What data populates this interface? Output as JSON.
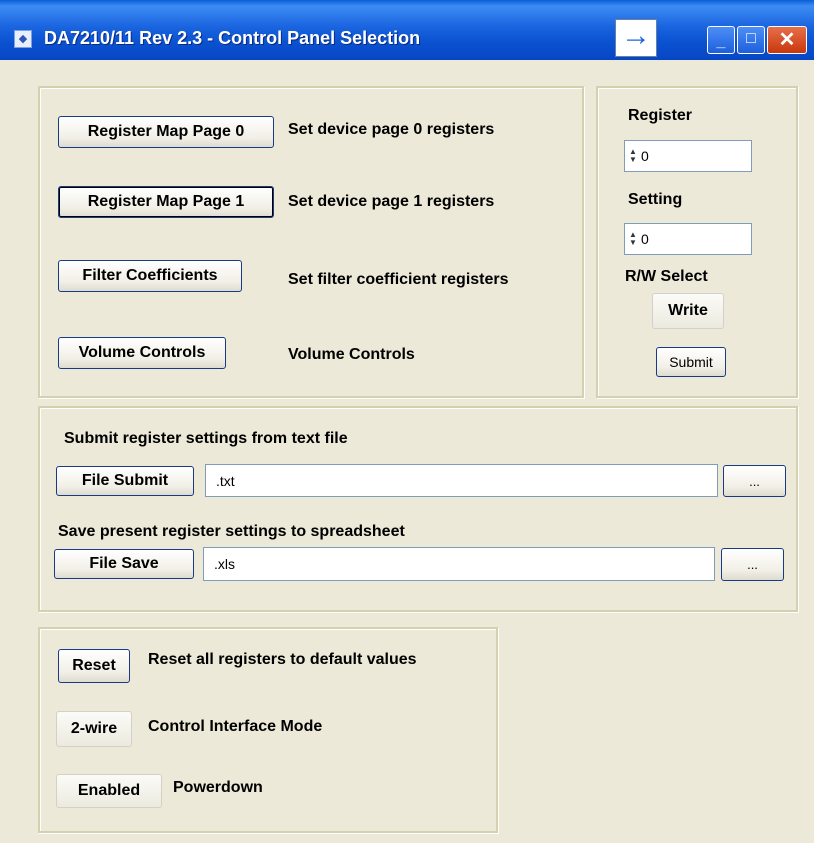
{
  "window": {
    "title": "DA7210/11 Rev 2.3 - Control Panel Selection",
    "arrow_glyph": "→",
    "minimize_glyph": "_",
    "maximize_glyph": "□",
    "close_glyph": "✕"
  },
  "pages": {
    "items": [
      {
        "button": "Register Map Page 0",
        "desc": "Set device page 0 registers"
      },
      {
        "button": "Register Map Page 1",
        "desc": "Set device page 1 registers"
      },
      {
        "button": "Filter Coefficients",
        "desc": "Set filter coefficient registers"
      },
      {
        "button": "Volume Controls",
        "desc": "Volume Controls"
      }
    ]
  },
  "register_panel": {
    "register_label": "Register",
    "register_value": "0",
    "setting_label": "Setting",
    "setting_value": "0",
    "rw_label": "R/W Select",
    "rw_button": "Write",
    "submit_button": "Submit"
  },
  "file_panel": {
    "submit_heading": "Submit register settings from text file",
    "submit_button": "File Submit",
    "submit_path": ".txt",
    "browse_label": "...",
    "save_heading": "Save present register settings to spreadsheet",
    "save_button": "File Save",
    "save_path": ".xls"
  },
  "control_panel": {
    "reset_button": "Reset",
    "reset_desc": "Reset all registers to default values",
    "mode_button": "2-wire",
    "mode_desc": "Control Interface Mode",
    "power_button": "Enabled",
    "power_desc": "Powerdown"
  },
  "colors": {
    "titlebar": "#0b52d0",
    "face": "#ece9d8",
    "button_border": "#1a3a86",
    "field_border": "#7f9db9"
  }
}
